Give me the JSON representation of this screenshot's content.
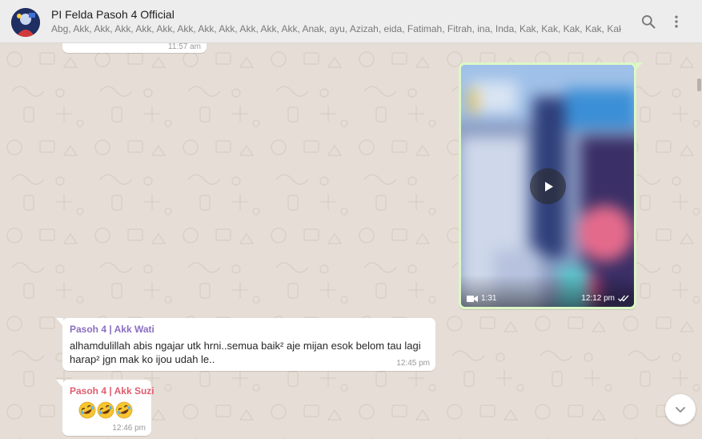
{
  "header": {
    "title": "PI Felda Pasoh 4 Official",
    "members": "Abg, Akk, Akk, Akk, Akk, Akk, Akk, Akk, Akk, Akk, Akk, Akk, Anak, ayu, Azizah, eida, Fatimah, Fitrah, ina, Inda, Kak, Kak, Kak, Kak, Kak, Umi,...",
    "search_icon": "search-icon",
    "menu_icon": "more-vertical-icon"
  },
  "colors": {
    "header_bg": "#ededed",
    "chat_bg": "#e6ded6",
    "outgoing_bubble": "#dcf8c6",
    "incoming_bubble": "#ffffff",
    "sender_wati": "#8a6ec0",
    "sender_suzi": "#e05d6f"
  },
  "messages": [
    {
      "type": "text-stub",
      "direction": "incoming",
      "time": "11:57 am"
    },
    {
      "type": "video",
      "direction": "outgoing",
      "duration": "1:31",
      "time": "12:12 pm",
      "status_icon": "double-check-icon",
      "play_icon": "play-icon",
      "video_icon": "video-camera-icon"
    },
    {
      "type": "text",
      "direction": "incoming",
      "sender": "Pasoh 4 | Akk Wati",
      "line1": "alhamdulillah abis ngajar utk hrni..semua baik² aje mijan esok belom tau lagi",
      "line2": "harap² jgn mak ko ijou udah le..",
      "time": "12:45 pm"
    },
    {
      "type": "text",
      "direction": "incoming",
      "sender": "Pasoh 4 | Akk Suzi",
      "emoji": "🤣🤣🤣",
      "time": "12:46 pm"
    }
  ],
  "scroll_down": {
    "icon": "chevron-down-icon"
  }
}
